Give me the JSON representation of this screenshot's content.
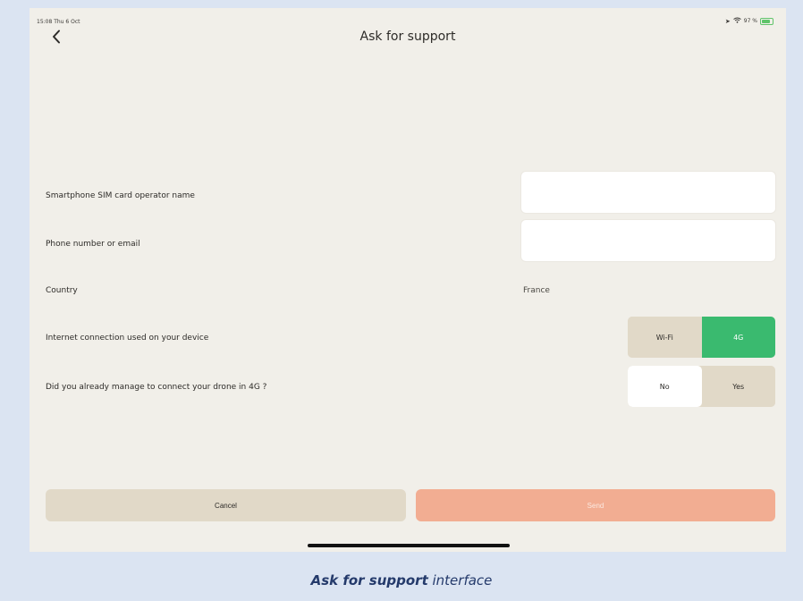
{
  "status_bar": {
    "time": "15:08",
    "date": "Thu 6 Oct",
    "battery": "97 %",
    "icons": [
      "location-icon",
      "wifi-icon",
      "battery-icon"
    ]
  },
  "header": {
    "title": "Ask for support",
    "back_icon": "chevron-left-icon"
  },
  "form": {
    "sim_operator": {
      "label": "Smartphone SIM card operator name",
      "value": "",
      "placeholder": ""
    },
    "contact": {
      "label": "Phone number or email",
      "value": "",
      "placeholder": ""
    },
    "country": {
      "label": "Country",
      "value": "France"
    },
    "connection": {
      "label": "Internet connection used on your device",
      "options": [
        "Wi-Fi",
        "4G"
      ],
      "selected": "4G"
    },
    "drone_4g": {
      "label": "Did you already manage to connect your drone in 4G ?",
      "options": [
        "No",
        "Yes"
      ],
      "selected": "No"
    }
  },
  "actions": {
    "cancel_label": "Cancel",
    "send_label": "Send"
  },
  "caption": {
    "bold": "Ask for support",
    "rest": " interface"
  },
  "colors": {
    "screen_bg": "#f1efe9",
    "segment_neutral": "#e1d9c8",
    "selected_green": "#3aba6f",
    "send_disabled": "#f2ad92",
    "caption_text": "#243a6b"
  }
}
